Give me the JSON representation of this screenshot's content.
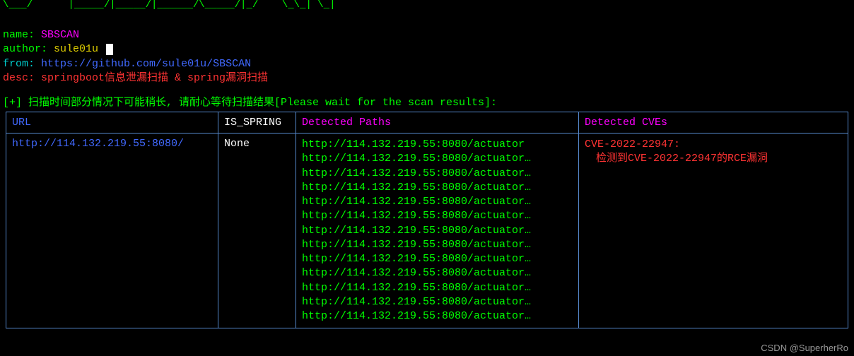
{
  "ascii_art": "\\___/      |_____/|_____/|______/\\_____/|_/    \\_\\_| \\_|\n                                                       ",
  "info": {
    "name_label": "name:",
    "name_value": "SBSCAN",
    "author_label": "author:",
    "author_value": "sule01u",
    "from_label": "from:",
    "from_value": "https://github.com/sule01u/SBSCAN",
    "desc_label": "desc:",
    "desc_value": "springboot信息泄漏扫描 & spring漏洞扫描"
  },
  "scan_message": "[+] 扫描时间部分情况下可能稍长, 请耐心等待扫描结果[Please wait for the scan results]:",
  "headers": {
    "url": "URL",
    "is_spring": "IS_SPRING",
    "paths": "Detected Paths",
    "cves": "Detected CVEs"
  },
  "row": {
    "url": "http://114.132.219.55:8080/",
    "is_spring": "None",
    "paths": [
      "http://114.132.219.55:8080/actuator",
      "http://114.132.219.55:8080/actuator…",
      "http://114.132.219.55:8080/actuator…",
      "http://114.132.219.55:8080/actuator…",
      "http://114.132.219.55:8080/actuator…",
      "http://114.132.219.55:8080/actuator…",
      "http://114.132.219.55:8080/actuator…",
      "http://114.132.219.55:8080/actuator…",
      "http://114.132.219.55:8080/actuator…",
      "http://114.132.219.55:8080/actuator…",
      "http://114.132.219.55:8080/actuator…",
      "http://114.132.219.55:8080/actuator…",
      "http://114.132.219.55:8080/actuator…"
    ],
    "cve_title": "CVE-2022-22947:",
    "cve_detail": "检测到CVE-2022-22947的RCE漏洞"
  },
  "watermark": "CSDN @SuperherRo"
}
